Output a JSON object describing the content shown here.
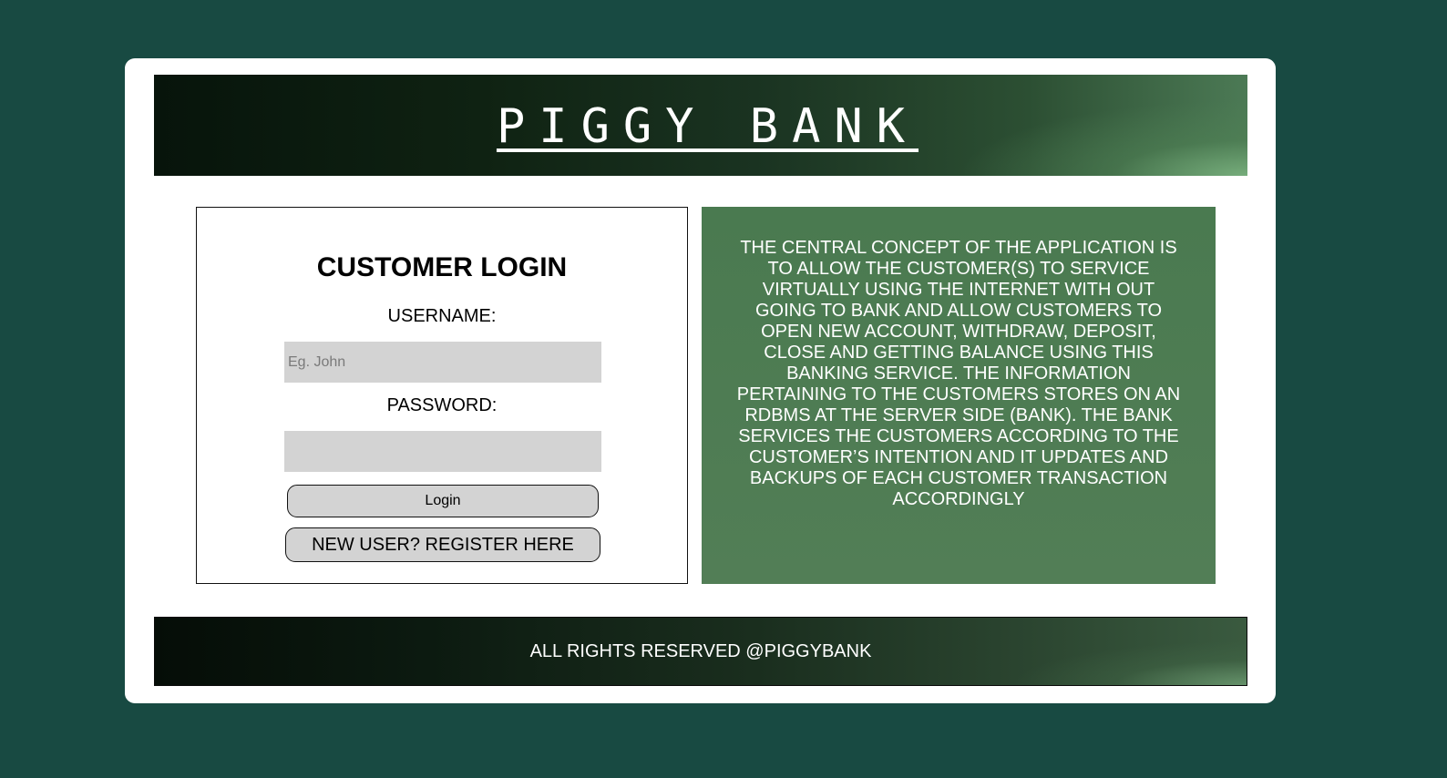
{
  "header": {
    "title": "PIGGY BANK"
  },
  "login": {
    "title": "CUSTOMER LOGIN",
    "username_label": "USERNAME:",
    "username_placeholder": "Eg. John",
    "username_value": "",
    "password_label": "PASSWORD:",
    "password_value": "",
    "login_button": "Login",
    "register_button": "NEW USER? REGISTER HERE"
  },
  "info": {
    "text": "THE CENTRAL CONCEPT OF THE APPLICATION IS TO ALLOW THE CUSTOMER(S) TO SERVICE VIRTUALLY USING THE INTERNET WITH OUT GOING TO BANK AND ALLOW CUSTOMERS TO OPEN NEW ACCOUNT, WITHDRAW, DEPOSIT, CLOSE AND GETTING BALANCE USING THIS BANKING SERVICE.  THE INFORMATION PERTAINING TO THE CUSTOMERS STORES ON AN RDBMS AT THE SERVER SIDE (BANK).  THE BANK SERVICES THE CUSTOMERS ACCORDING TO THE CUSTOMER’S INTENTION AND IT UPDATES AND BACKUPS OF EACH CUSTOMER TRANSACTION ACCORDINGLY"
  },
  "footer": {
    "text": "ALL RIGHTS RESERVED @PIGGYBANK"
  },
  "colors": {
    "page_background": "#184a42",
    "info_background": "#4d7c53",
    "input_background": "#d3d3d3"
  }
}
